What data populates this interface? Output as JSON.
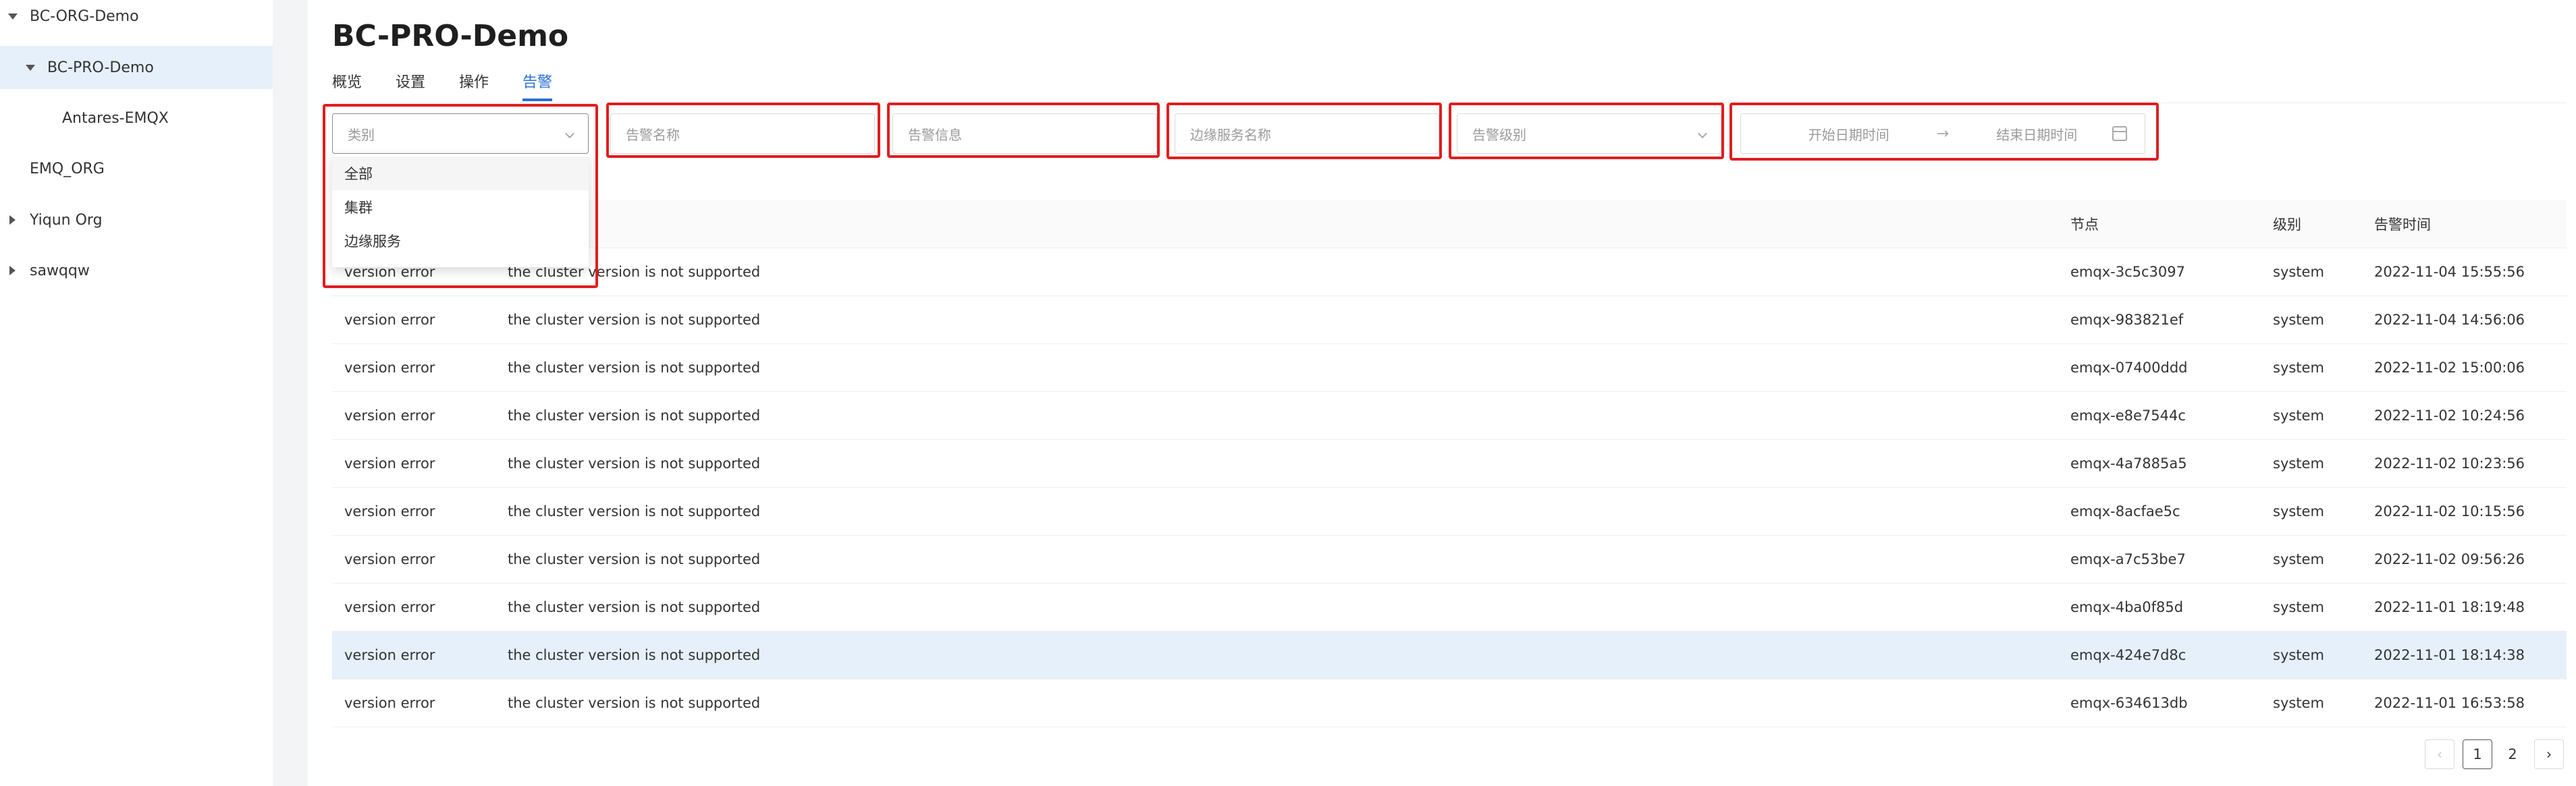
{
  "sidebar": {
    "items": [
      {
        "label": "BC-ORG-Demo",
        "caret": "down"
      },
      {
        "label": "BC-PRO-Demo",
        "caret": "down"
      },
      {
        "label": "Antares-EMQX",
        "caret": ""
      },
      {
        "label": "EMQ_ORG",
        "caret": ""
      },
      {
        "label": "Yiqun Org",
        "caret": "right"
      },
      {
        "label": "sawqqw",
        "caret": "right"
      }
    ]
  },
  "page": {
    "title": "BC-PRO-Demo",
    "tabs": [
      "概览",
      "设置",
      "操作",
      "告警"
    ],
    "active_tab": "告警"
  },
  "filters": {
    "category": {
      "placeholder": "类别"
    },
    "alarm_name": {
      "placeholder": "告警名称"
    },
    "alarm_info": {
      "placeholder": "告警信息"
    },
    "edge_service_name": {
      "placeholder": "边缘服务名称"
    },
    "alarm_level": {
      "placeholder": "告警级别"
    },
    "date_range": {
      "start_placeholder": "开始日期时间",
      "end_placeholder": "结束日期时间",
      "separator": "→"
    }
  },
  "dropdown": {
    "options": [
      "全部",
      "集群",
      "边缘服务"
    ]
  },
  "table": {
    "headers": [
      "",
      "",
      "节点",
      "级别",
      "告警时间"
    ],
    "rows": [
      [
        "version error",
        "the cluster version is not supported",
        "emqx-3c5c3097",
        "system",
        "2022-11-04 15:55:56"
      ],
      [
        "version error",
        "the cluster version is not supported",
        "emqx-983821ef",
        "system",
        "2022-11-04 14:56:06"
      ],
      [
        "version error",
        "the cluster version is not supported",
        "emqx-07400ddd",
        "system",
        "2022-11-02 15:00:06"
      ],
      [
        "version error",
        "the cluster version is not supported",
        "emqx-e8e7544c",
        "system",
        "2022-11-02 10:24:56"
      ],
      [
        "version error",
        "the cluster version is not supported",
        "emqx-4a7885a5",
        "system",
        "2022-11-02 10:23:56"
      ],
      [
        "version error",
        "the cluster version is not supported",
        "emqx-8acfae5c",
        "system",
        "2022-11-02 10:15:56"
      ],
      [
        "version error",
        "the cluster version is not supported",
        "emqx-a7c53be7",
        "system",
        "2022-11-02 09:56:26"
      ],
      [
        "version error",
        "the cluster version is not supported",
        "emqx-4ba0f85d",
        "system",
        "2022-11-01 18:19:48"
      ],
      [
        "version error",
        "the cluster version is not supported",
        "emqx-424e7d8c",
        "system",
        "2022-11-01 18:14:38"
      ],
      [
        "version error",
        "the cluster version is not supported",
        "emqx-634613db",
        "system",
        "2022-11-01 16:53:58"
      ]
    ]
  },
  "pagination": {
    "prev": "‹",
    "pages": [
      "1",
      "2"
    ],
    "current": "1",
    "next": "›"
  },
  "colors": {
    "accent": "#2b6fd6",
    "highlight_box": "#e01e1e",
    "selected_bg": "#e6f0fb"
  }
}
